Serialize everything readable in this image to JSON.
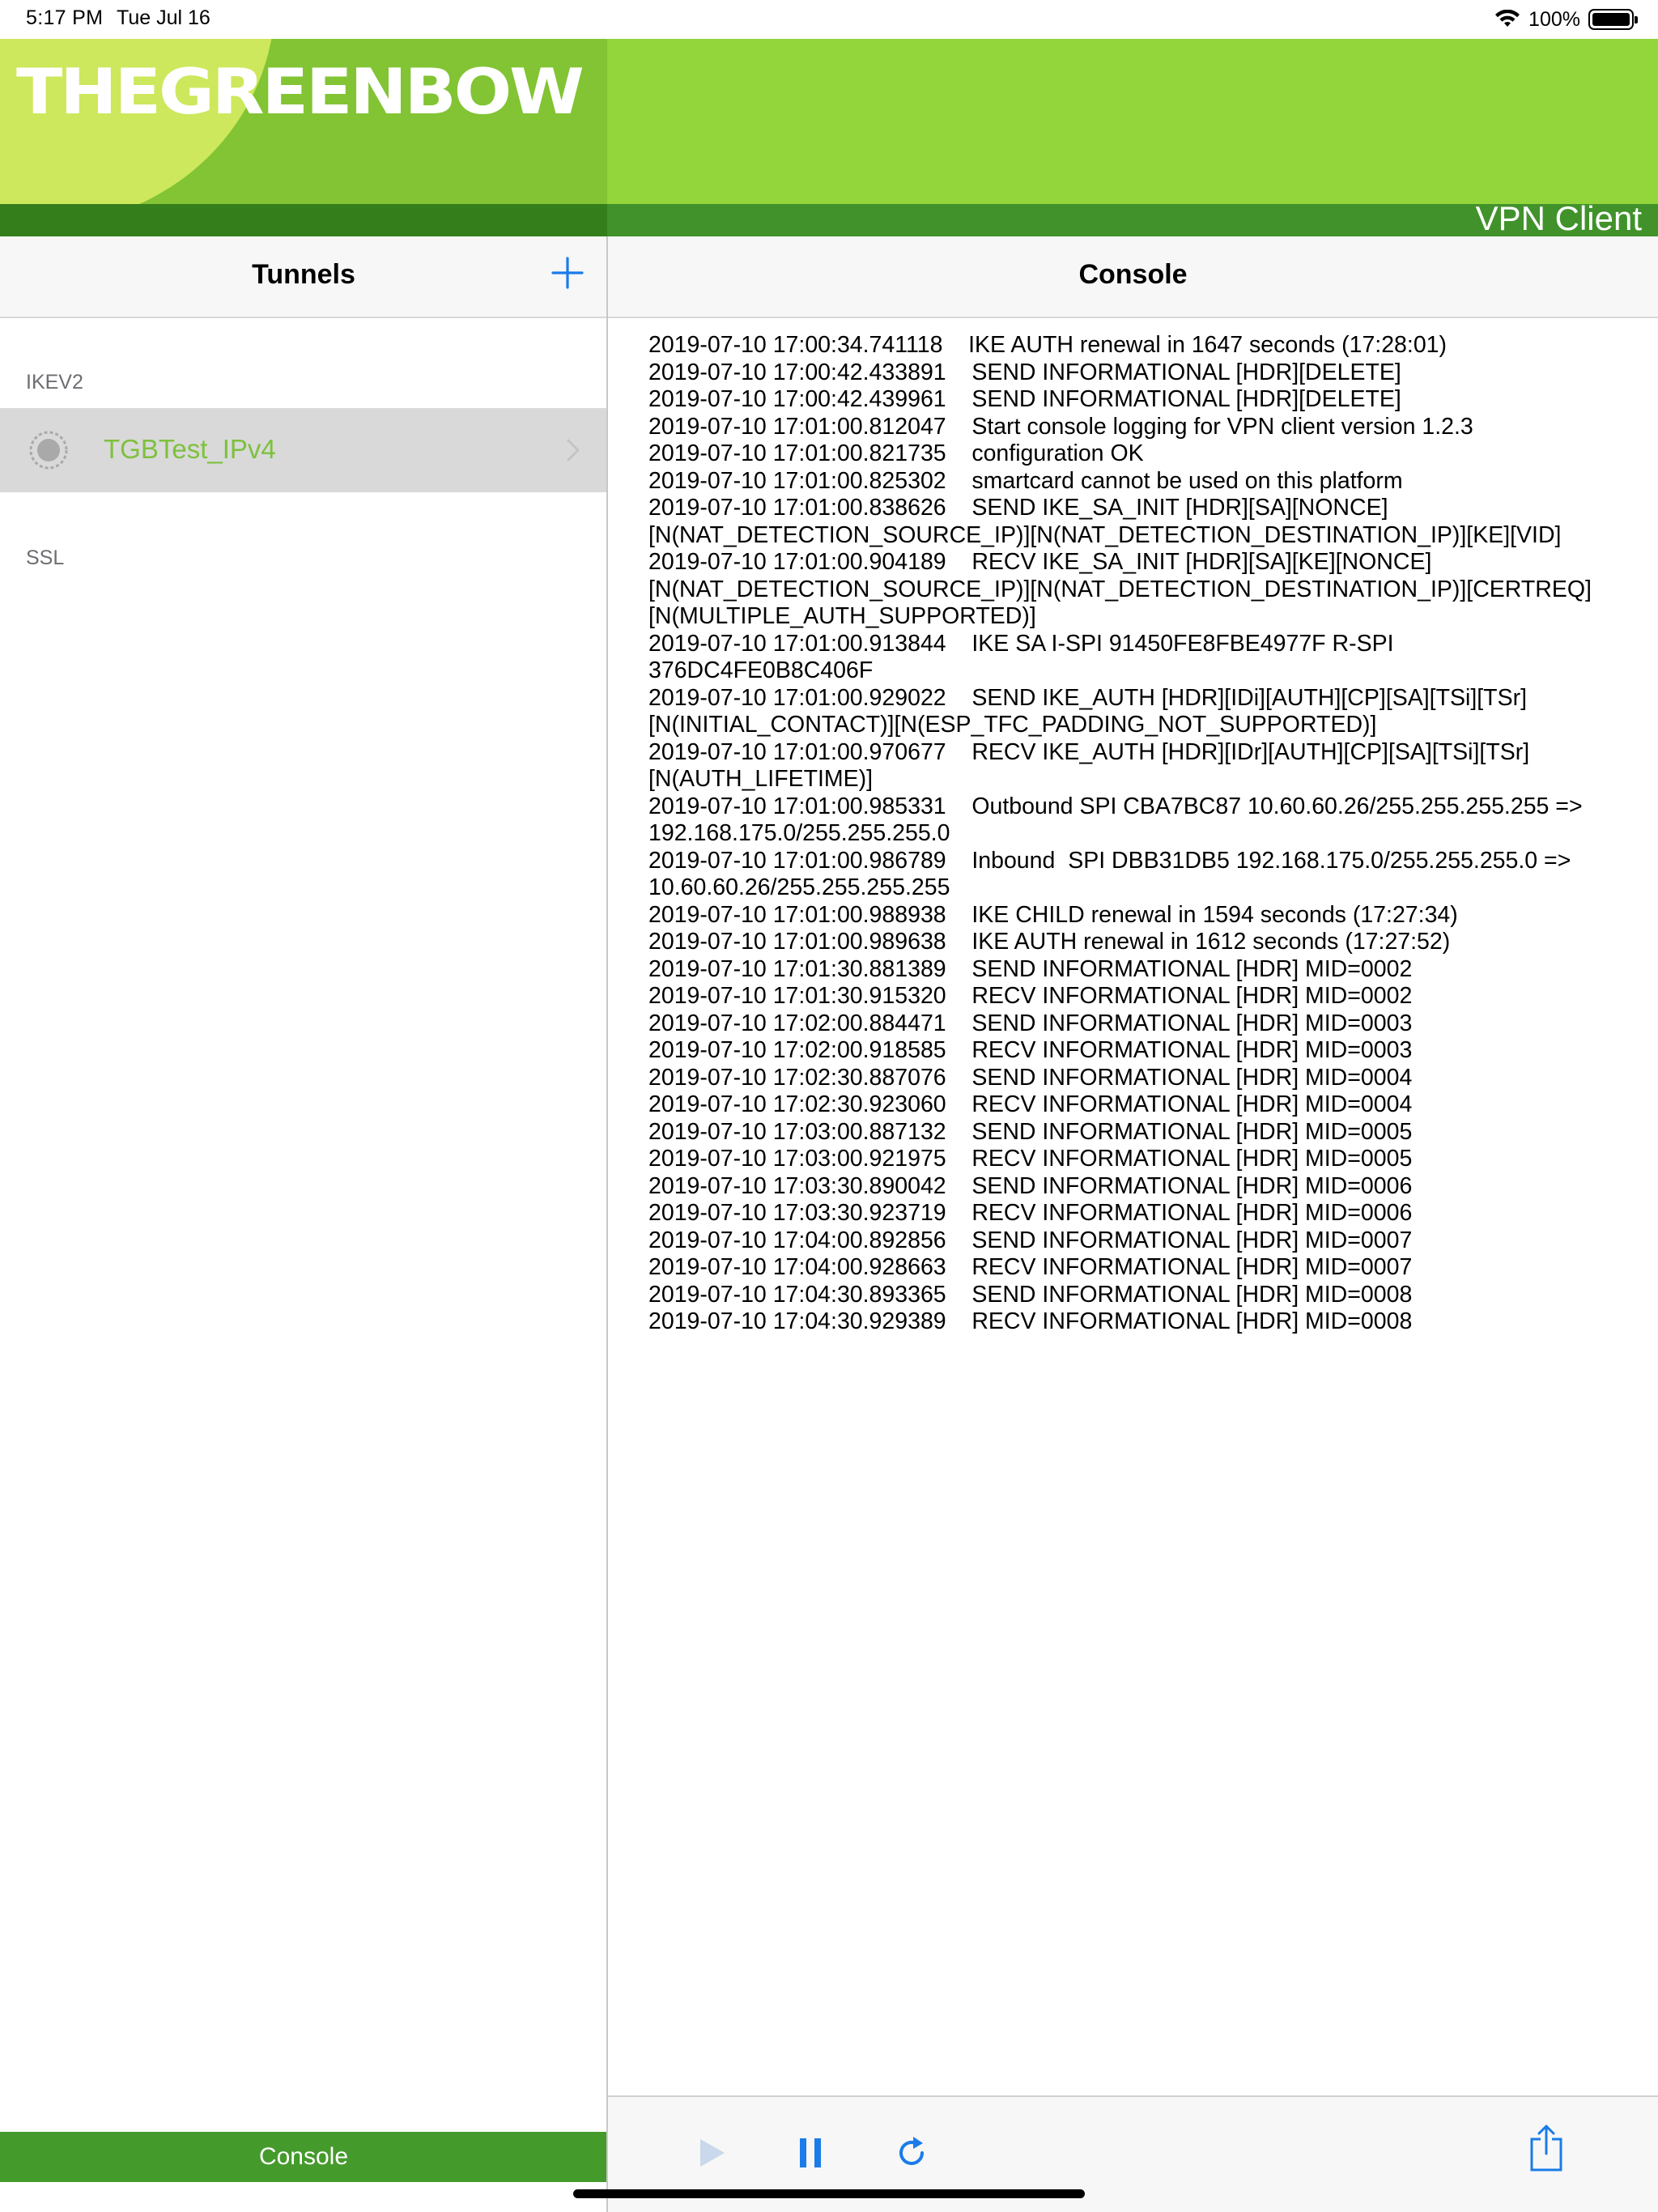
{
  "status_bar": {
    "time": "5:17 PM",
    "date": "Tue Jul 16",
    "battery": "100%"
  },
  "banner": {
    "brand": "THEGREENBOW",
    "product": "VPN Client"
  },
  "sidebar": {
    "title": "Tunnels",
    "sections": [
      {
        "label": "IKEV2",
        "items": [
          {
            "label": "TGBTest_IPv4"
          }
        ]
      },
      {
        "label": "SSL",
        "items": []
      }
    ],
    "bottom_tab": "Console"
  },
  "console": {
    "title": "Console",
    "lines": [
      "2019-07-10 17:00:34.741118    IKE AUTH renewal in 1647 seconds (17:28:01)",
      "2019-07-10 17:00:42.433891    SEND INFORMATIONAL [HDR][DELETE]",
      "2019-07-10 17:00:42.439961    SEND INFORMATIONAL [HDR][DELETE]",
      "2019-07-10 17:01:00.812047    Start console logging for VPN client version 1.2.3",
      "2019-07-10 17:01:00.821735    configuration OK",
      "2019-07-10 17:01:00.825302    smartcard cannot be used on this platform",
      "2019-07-10 17:01:00.838626    SEND IKE_SA_INIT [HDR][SA][NONCE]",
      "[N(NAT_DETECTION_SOURCE_IP)][N(NAT_DETECTION_DESTINATION_IP)][KE][VID]",
      "2019-07-10 17:01:00.904189    RECV IKE_SA_INIT [HDR][SA][KE][NONCE]",
      "[N(NAT_DETECTION_SOURCE_IP)][N(NAT_DETECTION_DESTINATION_IP)][CERTREQ]",
      "[N(MULTIPLE_AUTH_SUPPORTED)]",
      "2019-07-10 17:01:00.913844    IKE SA I-SPI 91450FE8FBE4977F R-SPI",
      "376DC4FE0B8C406F",
      "2019-07-10 17:01:00.929022    SEND IKE_AUTH [HDR][IDi][AUTH][CP][SA][TSi][TSr]",
      "[N(INITIAL_CONTACT)][N(ESP_TFC_PADDING_NOT_SUPPORTED)]",
      "2019-07-10 17:01:00.970677    RECV IKE_AUTH [HDR][IDr][AUTH][CP][SA][TSi][TSr]",
      "[N(AUTH_LIFETIME)]",
      "2019-07-10 17:01:00.985331    Outbound SPI CBA7BC87 10.60.60.26/255.255.255.255 =>",
      "192.168.175.0/255.255.255.0",
      "2019-07-10 17:01:00.986789    Inbound  SPI DBB31DB5 192.168.175.0/255.255.255.0 =>",
      "10.60.60.26/255.255.255.255",
      "2019-07-10 17:01:00.988938    IKE CHILD renewal in 1594 seconds (17:27:34)",
      "2019-07-10 17:01:00.989638    IKE AUTH renewal in 1612 seconds (17:27:52)",
      "2019-07-10 17:01:30.881389    SEND INFORMATIONAL [HDR] MID=0002",
      "2019-07-10 17:01:30.915320    RECV INFORMATIONAL [HDR] MID=0002",
      "2019-07-10 17:02:00.884471    SEND INFORMATIONAL [HDR] MID=0003",
      "2019-07-10 17:02:00.918585    RECV INFORMATIONAL [HDR] MID=0003",
      "2019-07-10 17:02:30.887076    SEND INFORMATIONAL [HDR] MID=0004",
      "2019-07-10 17:02:30.923060    RECV INFORMATIONAL [HDR] MID=0004",
      "2019-07-10 17:03:00.887132    SEND INFORMATIONAL [HDR] MID=0005",
      "2019-07-10 17:03:00.921975    RECV INFORMATIONAL [HDR] MID=0005",
      "2019-07-10 17:03:30.890042    SEND INFORMATIONAL [HDR] MID=0006",
      "2019-07-10 17:03:30.923719    RECV INFORMATIONAL [HDR] MID=0006",
      "2019-07-10 17:04:00.892856    SEND INFORMATIONAL [HDR] MID=0007",
      "2019-07-10 17:04:00.928663    RECV INFORMATIONAL [HDR] MID=0007",
      "2019-07-10 17:04:30.893365    SEND INFORMATIONAL [HDR] MID=0008",
      "2019-07-10 17:04:30.929389    RECV INFORMATIONAL [HDR] MID=0008"
    ]
  },
  "icons": {
    "add": "plus-icon",
    "tunnel_status": "spinner-icon",
    "disclosure": "chevron-right-icon",
    "play": "play-icon",
    "pause": "pause-icon",
    "refresh": "refresh-icon",
    "share": "share-icon"
  },
  "colors": {
    "accent_blue": "#1a7ce8",
    "brand_green": "#92d63b",
    "brand_dark_green": "#459a2c",
    "tunnel_label_green": "#7dc13d"
  }
}
